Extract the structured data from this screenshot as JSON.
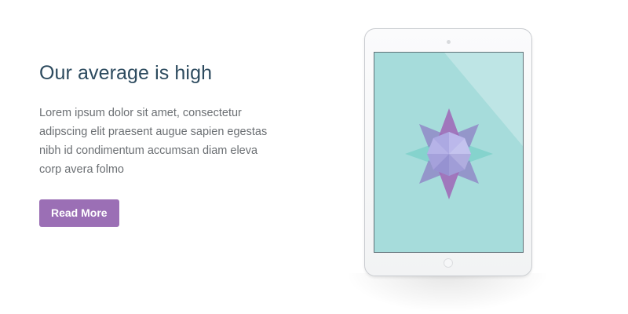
{
  "feature": {
    "heading": "Our average is high",
    "body": "Lorem ipsum dolor sit amet, consectetur adipscing elit praesent augue sapien egestas nibh id condimentum accumsan diam eleva corp avera folmo",
    "button_label": "Read More"
  },
  "colors": {
    "heading": "#2c4a5e",
    "body_text": "#6b6f73",
    "button": "#9b6fb5",
    "screen": "#a6dcdb",
    "ornament_primary": "#9b6fb5",
    "ornament_secondary": "#77c8c6"
  },
  "device": {
    "icon": "tablet-icon",
    "screen_graphic": "star-ornament-icon"
  }
}
